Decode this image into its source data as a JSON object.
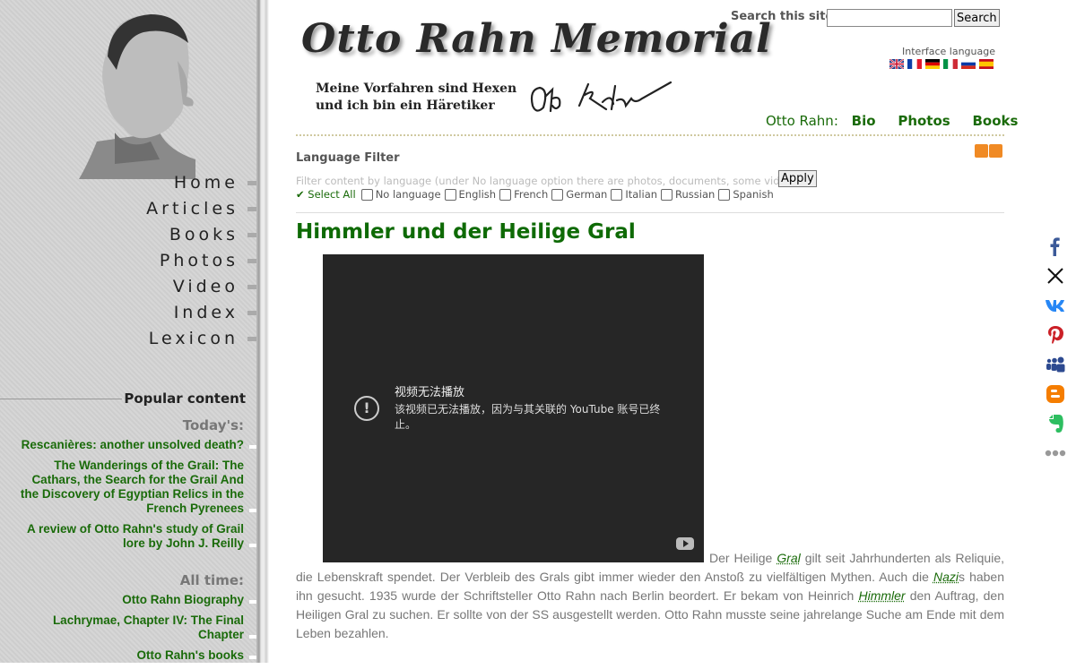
{
  "sidebar": {
    "nav": [
      "Home",
      "Articles",
      "Books",
      "Photos",
      "Video",
      "Index",
      "Lexicon"
    ],
    "popular_title": "Popular content",
    "today_title": "Today's:",
    "today": [
      "Rescanières: another unsolved death?",
      "The Wanderings of the Grail: The Cathars, the Search for the Grail And the Discovery of Egyptian Relics in the French Pyrenees",
      "A review of Otto Rahn's study of Grail lore by John J. Reilly"
    ],
    "alltime_title": "All time:",
    "alltime": [
      "Otto Rahn Biography",
      "Lachrymae, Chapter IV: The Final Chapter",
      "Otto Rahn's books"
    ]
  },
  "header": {
    "title": "Otto Rahn Memorial",
    "motto_line1": "Meine Vorfahren sind Hexen",
    "motto_line2": "und ich bin ein Häretiker",
    "search_label": "Search this site:",
    "search_value": "",
    "search_button": "Search",
    "interface_language": "Interface language",
    "flags": [
      "uk",
      "fr",
      "de",
      "it",
      "ru",
      "es"
    ],
    "author_label": "Otto Rahn:",
    "author_links": [
      "Bio",
      "Photos",
      "Books"
    ]
  },
  "filter": {
    "title": "Language Filter",
    "hint": "Filter content by language (under No language option there are photos, documents, some videos)",
    "apply": "Apply",
    "select_all": "Select All",
    "options": [
      "No language",
      "English",
      "French",
      "German",
      "Italian",
      "Russian",
      "Spanish"
    ]
  },
  "article": {
    "title": "Himmler und der Heilige Gral",
    "video_title": "视频无法播放",
    "video_message": "该视频已无法播放，因为与其关联的 YouTube 账号已终止。",
    "p1": "Der Heilige ",
    "l1": "Gral",
    "p2": " gilt seit Jahrhunderten als Reliquie, die Lebenskraft spendet. Der Verbleib des Grals gibt immer wieder den Anstoß zu vielfältigen Mythen. Auch die ",
    "l2": "Nazi",
    "p3": "s haben ihn gesucht. 1935 wurde der Schriftsteller Otto Rahn nach Berlin beordert. Er bekam von Heinrich ",
    "l3": "Himmler",
    "p4": " den Auftrag, den Heiligen Gral zu suchen. Er sollte von der SS ausgestellt werden. Otto Rahn musste seine jahrelange Suche am Ende mit dem Leben bezahlen."
  },
  "share": [
    "facebook-icon",
    "x-icon",
    "vk-icon",
    "pinterest-icon",
    "myspace-icon",
    "blogger-icon",
    "evernote-icon",
    "more-icon"
  ],
  "colors": {
    "link_green": "#1a6b0a",
    "title_green": "#0e6a05",
    "sidebar_gray": "#d4d4d4"
  }
}
